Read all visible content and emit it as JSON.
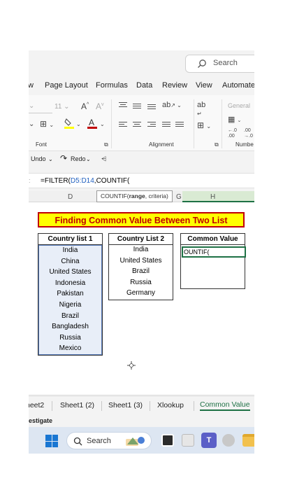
{
  "search": {
    "placeholder": "Search"
  },
  "ribbon_tabs": [
    "w",
    "Page Layout",
    "Formulas",
    "Data",
    "Review",
    "View",
    "Automate"
  ],
  "ribbon": {
    "font_size": "11",
    "style_label": "General",
    "group_font": "Font",
    "group_alignment": "Alignment",
    "group_number": "Numbe"
  },
  "undo_bar": {
    "undo": "Undo",
    "redo": "Redo"
  },
  "formula_bar": {
    "prefix": "=FILTER(",
    "range_ref": "D5:D14",
    "suffix": ",COUNTIF("
  },
  "tooltip": {
    "fn": "COUNTIF(",
    "arg_bold": "range",
    "rest": ", criteria)"
  },
  "columns": [
    "D",
    "G",
    "H"
  ],
  "title": "Finding Common Value Between Two List",
  "list1": {
    "header": "Country list 1",
    "items": [
      "India",
      "China",
      "United States",
      "Indonesia",
      "Pakistan",
      "Nigeria",
      "Brazil",
      "Bangladesh",
      "Russia",
      "Mexico"
    ]
  },
  "list2": {
    "header": "Country List 2",
    "items": [
      "India",
      "United States",
      "Brazil",
      "Russia",
      "Germany"
    ]
  },
  "common": {
    "header": "Common Value",
    "editing_text": "OUNTIF("
  },
  "sheet_tabs": [
    "heet2",
    "Sheet1 (2)",
    "Sheet1 (3)",
    "Xlookup",
    "Common Value"
  ],
  "status": "estigate",
  "taskbar": {
    "search": "Search"
  },
  "colors": {
    "excel_green": "#1e7145",
    "title_red": "#c00000",
    "title_yellow": "#ffff00"
  }
}
